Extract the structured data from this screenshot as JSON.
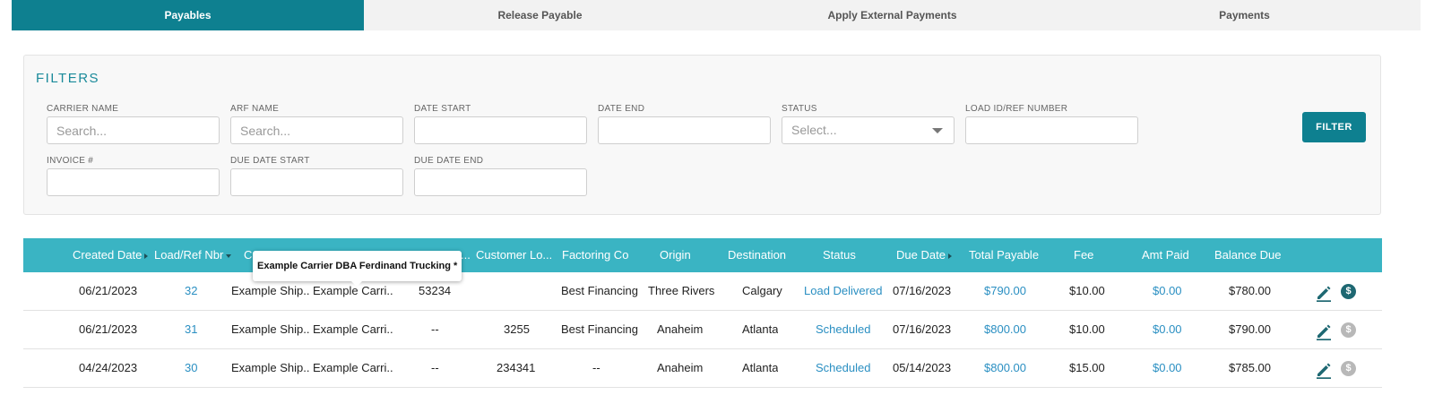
{
  "colors": {
    "brand": "#0e8090",
    "table_header": "#3ab4c3",
    "link": "#2a8fc2",
    "pay_active": "#1e6872",
    "pay_inactive": "#b8b8b8"
  },
  "tabs": [
    {
      "label": "Payables",
      "active": true
    },
    {
      "label": "Release Payable",
      "active": false
    },
    {
      "label": "Apply External Payments",
      "active": false
    },
    {
      "label": "Payments",
      "active": false
    }
  ],
  "filters": {
    "title": "FILTERS",
    "carrier_name": {
      "label": "CARRIER NAME",
      "placeholder": "Search...",
      "value": ""
    },
    "arf_name": {
      "label": "ARF NAME",
      "placeholder": "Search...",
      "value": ""
    },
    "date_start": {
      "label": "DATE START",
      "value": ""
    },
    "date_end": {
      "label": "DATE END",
      "value": ""
    },
    "status": {
      "label": "STATUS",
      "placeholder": "Select..."
    },
    "load_id": {
      "label": "LOAD ID/REF NUMBER",
      "value": ""
    },
    "invoice": {
      "label": "INVOICE #",
      "value": ""
    },
    "due_date_start": {
      "label": "DUE DATE START",
      "value": ""
    },
    "due_date_end": {
      "label": "DUE DATE END",
      "value": ""
    },
    "button": "FILTER"
  },
  "table": {
    "headers": {
      "created_date": "Created Date",
      "load_ref": "Load/Ref Nbr",
      "shipper": "C",
      "load_num": "...",
      "customer_lo": "Customer Lo...",
      "factoring_co": "Factoring Co",
      "origin": "Origin",
      "destination": "Destination",
      "status": "Status",
      "due_date": "Due Date",
      "total_payable": "Total Payable",
      "fee": "Fee",
      "amt_paid": "Amt Paid",
      "balance_due": "Balance Due"
    },
    "rows": [
      {
        "created_date": "06/21/2023",
        "load_ref": "32",
        "shipper": "Example Ship...",
        "carrier": "Example Carri...",
        "load_num": "53234",
        "customer_lo": "",
        "factoring_co": "Best Financing",
        "origin": "Three Rivers",
        "destination": "Calgary",
        "status": "Load Delivered",
        "due_date": "07/16/2023",
        "total_payable": "$790.00",
        "fee": "$10.00",
        "amt_paid": "$0.00",
        "balance_due": "$780.00",
        "pay_enabled": true
      },
      {
        "created_date": "06/21/2023",
        "load_ref": "31",
        "shipper": "Example Ship...",
        "carrier": "Example Carri...",
        "load_num": "--",
        "customer_lo": "3255",
        "factoring_co": "Best Financing",
        "origin": "Anaheim",
        "destination": "Atlanta",
        "status": "Scheduled",
        "due_date": "07/16/2023",
        "total_payable": "$800.00",
        "fee": "$10.00",
        "amt_paid": "$0.00",
        "balance_due": "$790.00",
        "pay_enabled": false
      },
      {
        "created_date": "04/24/2023",
        "load_ref": "30",
        "shipper": "Example Ship...",
        "carrier": "Example Carri...",
        "load_num": "--",
        "customer_lo": "234341",
        "factoring_co": "--",
        "origin": "Anaheim",
        "destination": "Atlanta",
        "status": "Scheduled",
        "due_date": "05/14/2023",
        "total_payable": "$800.00",
        "fee": "$15.00",
        "amt_paid": "$0.00",
        "balance_due": "$785.00",
        "pay_enabled": false
      }
    ]
  },
  "tooltip": {
    "text": "Example Carrier DBA Ferdinand Trucking *"
  },
  "icons": {
    "edit": "pencil-icon",
    "pay": "dollar-circle-icon"
  }
}
